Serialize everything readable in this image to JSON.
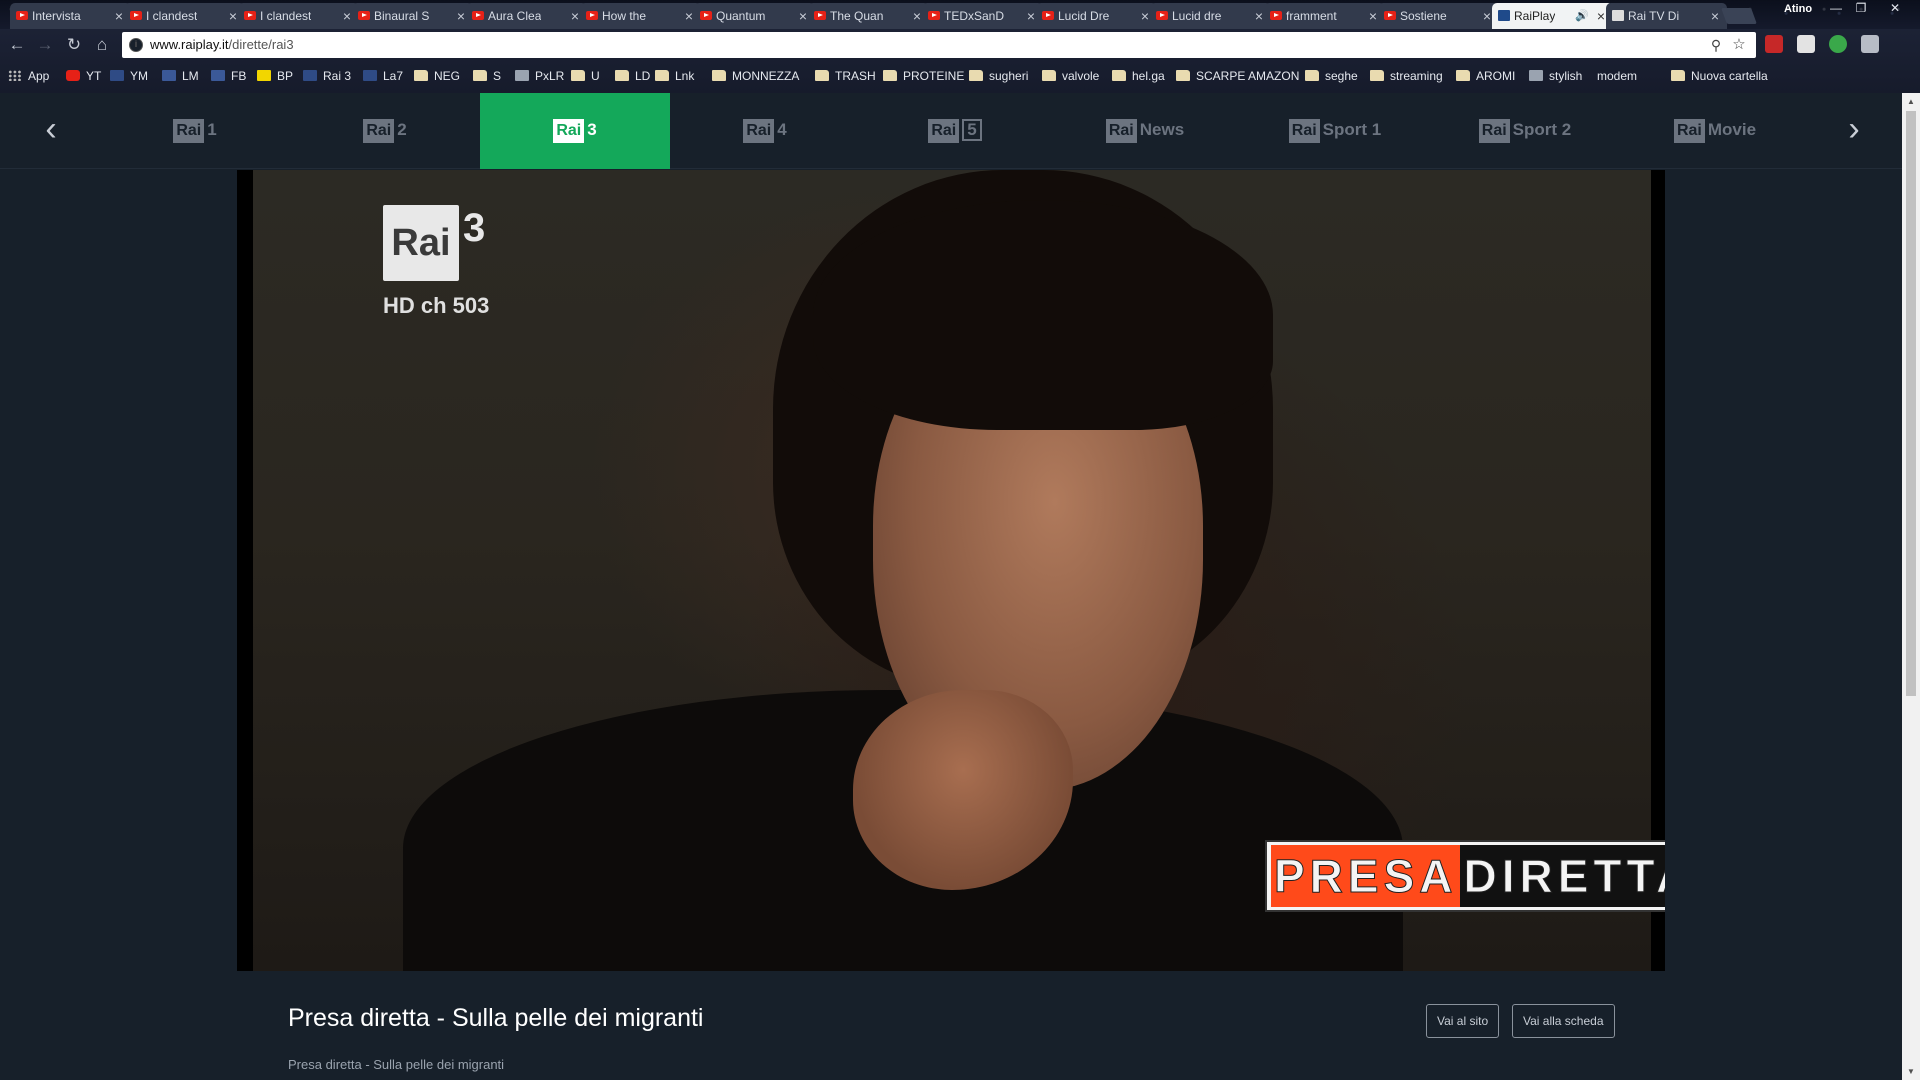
{
  "browser": {
    "tabs": [
      {
        "label": "Intervista",
        "favicon": "youtube-icon"
      },
      {
        "label": "I clandest",
        "favicon": "youtube-icon"
      },
      {
        "label": "I clandest",
        "favicon": "youtube-icon"
      },
      {
        "label": "Binaural S",
        "favicon": "youtube-icon"
      },
      {
        "label": "Aura Clea",
        "favicon": "youtube-icon"
      },
      {
        "label": "How the",
        "favicon": "youtube-icon"
      },
      {
        "label": "Quantum",
        "favicon": "youtube-icon"
      },
      {
        "label": "The Quan",
        "favicon": "youtube-icon"
      },
      {
        "label": "TEDxSanD",
        "favicon": "youtube-icon"
      },
      {
        "label": "Lucid Dre",
        "favicon": "youtube-icon"
      },
      {
        "label": "Lucid dre",
        "favicon": "youtube-icon"
      },
      {
        "label": "framment",
        "favicon": "youtube-icon"
      },
      {
        "label": "Sostiene",
        "favicon": "youtube-icon"
      },
      {
        "label": "RaiPlay",
        "favicon": "rai-icon",
        "active": true
      },
      {
        "label": "Rai TV Di",
        "favicon": "s-icon"
      }
    ],
    "profile_name": "Atino",
    "window_controls": {
      "minimize": "—",
      "restore": "❐",
      "close": "✕"
    },
    "address": {
      "host": "www.raiplay.it",
      "path": "/dirette/rai3"
    },
    "bookmarks": [
      {
        "label": "App",
        "icon": "apps"
      },
      {
        "label": "YT",
        "icon": "yt"
      },
      {
        "label": "YM",
        "icon": "dark"
      },
      {
        "label": "LM",
        "icon": "blue"
      },
      {
        "label": "FB",
        "icon": "blue"
      },
      {
        "label": "BP",
        "icon": "yellow"
      },
      {
        "label": "Rai 3",
        "icon": "dark"
      },
      {
        "label": "La7",
        "icon": "dark"
      },
      {
        "label": "NEG",
        "icon": "folder"
      },
      {
        "label": "S",
        "icon": "folder"
      },
      {
        "label": "PxLR",
        "icon": "grey"
      },
      {
        "label": "U",
        "icon": "folder"
      },
      {
        "label": "LD",
        "icon": "folder"
      },
      {
        "label": "Lnk",
        "icon": "folder"
      },
      {
        "label": "MONNEZZA",
        "icon": "folder"
      },
      {
        "label": "TRASH",
        "icon": "folder"
      },
      {
        "label": "PROTEINE",
        "icon": "folder"
      },
      {
        "label": "sugheri",
        "icon": "folder"
      },
      {
        "label": "valvole",
        "icon": "folder"
      },
      {
        "label": "hel.ga",
        "icon": "folder"
      },
      {
        "label": "SCARPE AMAZON",
        "icon": "folder"
      },
      {
        "label": "seghe",
        "icon": "folder"
      },
      {
        "label": "streaming",
        "icon": "folder"
      },
      {
        "label": "AROMI",
        "icon": "folder"
      },
      {
        "label": "stylish",
        "icon": "grey"
      },
      {
        "label": "modem",
        "icon": "page"
      },
      {
        "label": "Nuova cartella",
        "icon": "folder"
      }
    ]
  },
  "channels": [
    {
      "brand": "Rai",
      "name": "1"
    },
    {
      "brand": "Rai",
      "name": "2"
    },
    {
      "brand": "Rai",
      "name": "3",
      "active": true
    },
    {
      "brand": "Rai",
      "name": "4"
    },
    {
      "brand": "Rai",
      "name": "5"
    },
    {
      "brand": "Rai",
      "name": "News"
    },
    {
      "brand": "Rai",
      "name": "Sport 1"
    },
    {
      "brand": "Rai",
      "name": "Sport 2"
    },
    {
      "brand": "Rai",
      "name": "Movie"
    }
  ],
  "carousel": {
    "prev": "‹",
    "next": "›"
  },
  "player": {
    "bug_brand": "Rai",
    "bug_number": "3",
    "bug_subtitle": "HD ch 503",
    "program_logo_part1": "PRESA",
    "program_logo_part2": "DIRETTA"
  },
  "program": {
    "title": "Presa diretta - Sulla pelle dei migranti",
    "subtitle": "Presa diretta - Sulla pelle dei migranti",
    "site_button": "Vai al sito",
    "sheet_button": "Vai alla scheda"
  },
  "colors": {
    "accent_green": "#14a85a",
    "page_bg": "#17202a"
  }
}
